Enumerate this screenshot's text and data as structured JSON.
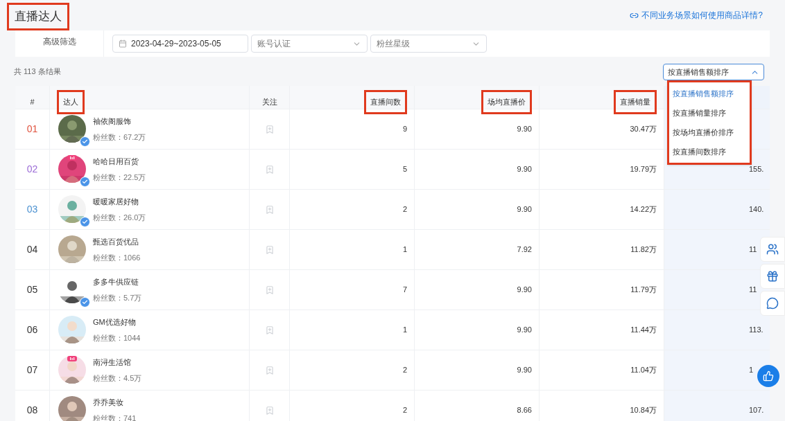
{
  "page": {
    "title": "直播达人",
    "title_annotated": true,
    "help_link": "不同业务场景如何使用商品详情?"
  },
  "filters": {
    "label": "高级筛选",
    "date_range": "2023-04-29~2023-05-05",
    "selects": [
      {
        "placeholder": "账号认证"
      },
      {
        "placeholder": "粉丝星级"
      }
    ]
  },
  "result_count": "共 113 条结果",
  "sort": {
    "value": "按直播销售额排序",
    "expanded": true,
    "annotated": true,
    "options": [
      {
        "label": "按直播销售额排序",
        "selected": true
      },
      {
        "label": "按直播销量排序",
        "selected": false
      },
      {
        "label": "按场均直播价排序",
        "selected": false
      },
      {
        "label": "按直播间数排序",
        "selected": false
      }
    ]
  },
  "table": {
    "columns": [
      {
        "label": "#",
        "annotated": false
      },
      {
        "label": "达人",
        "annotated": true
      },
      {
        "label": "关注",
        "annotated": false
      },
      {
        "label": "直播间数",
        "annotated": true
      },
      {
        "label": "场均直播价",
        "annotated": true
      },
      {
        "label": "直播销量",
        "annotated": true
      }
    ],
    "rows": [
      {
        "rank": "01",
        "color": "#e0523e",
        "name": "袖依阁服饰",
        "fans": "粉丝数：67.2万",
        "verified": true,
        "live": false,
        "rooms": "9",
        "avg_price": "9.90",
        "sales": "30.47万"
      },
      {
        "rank": "02",
        "color": "#9b6bd6",
        "name": "哈哈日用百货",
        "fans": "粉丝数：22.5万",
        "verified": true,
        "live": true,
        "rooms": "5",
        "avg_price": "9.90",
        "sales": "19.79万",
        "column_7": "155."
      },
      {
        "rank": "03",
        "color": "#4a90d0",
        "name": "暖暖家居好物",
        "fans": "粉丝数：26.0万",
        "verified": true,
        "live": false,
        "rooms": "2",
        "avg_price": "9.90",
        "sales": "14.22万",
        "column_7": "140."
      },
      {
        "rank": "04",
        "color": "#333333",
        "name": "甄选百货优品",
        "fans": "粉丝数：1066",
        "verified": false,
        "live": false,
        "rooms": "1",
        "avg_price": "7.92",
        "sales": "11.82万",
        "column_7": "11"
      },
      {
        "rank": "05",
        "color": "#333333",
        "name": "多多牛供应链",
        "fans": "粉丝数：5.7万",
        "verified": true,
        "live": false,
        "rooms": "7",
        "avg_price": "9.90",
        "sales": "11.79万",
        "column_7": "11"
      },
      {
        "rank": "06",
        "color": "#333333",
        "name": "GM优选好物",
        "fans": "粉丝数：1044",
        "verified": false,
        "live": false,
        "rooms": "1",
        "avg_price": "9.90",
        "sales": "11.44万",
        "column_7": "113."
      },
      {
        "rank": "07",
        "color": "#333333",
        "name": "南浔生活馆",
        "fans": "粉丝数：4.5万",
        "verified": false,
        "live": true,
        "rooms": "2",
        "avg_price": "9.90",
        "sales": "11.04万",
        "column_7": "1"
      },
      {
        "rank": "08",
        "color": "#333333",
        "name": "乔乔美妆",
        "fans": "粉丝数：741",
        "verified": false,
        "live": false,
        "rooms": "2",
        "avg_price": "8.66",
        "sales": "10.84万",
        "column_7": "107."
      }
    ]
  }
}
